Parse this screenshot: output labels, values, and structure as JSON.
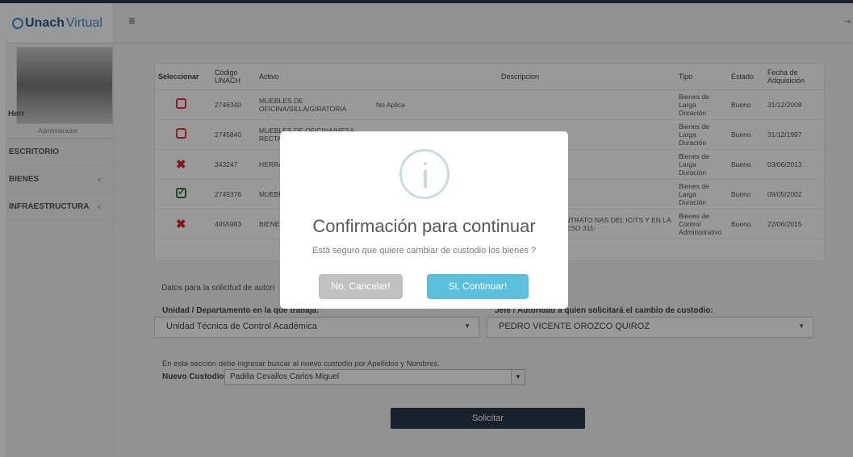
{
  "brand": {
    "bold": "Unach",
    "light": "Virtual"
  },
  "profile": {
    "name": "Herr",
    "role": "Administrador"
  },
  "nav": [
    {
      "label": "ESCRITORIO",
      "chevron": ""
    },
    {
      "label": "BIENES",
      "chevron": "<"
    },
    {
      "label": "INFRAESTRUCTURA",
      "chevron": "<"
    }
  ],
  "table": {
    "headers": [
      "Seleccionar",
      "Código UNACH",
      "Activo",
      "",
      "Descripcion",
      "Tipo",
      "Estado",
      "Fecha de Adquisición"
    ],
    "rows": [
      {
        "select": "unchecked",
        "codigo": "2746340",
        "activo": "MUEBLES DE OFICINA/SILLA/GIRATORIA",
        "extra": "No Aplica",
        "descripcion": "",
        "tipo": "Bienes de Larga Duración",
        "estado": "Bueno",
        "fecha": "31/12/2008"
      },
      {
        "select": "unchecked",
        "codigo": "2745840",
        "activo": "MUEBLES DE OFICINA/MESA RECTA",
        "extra": "",
        "descripcion": "",
        "tipo": "Bienes de Larga Duración",
        "estado": "Bueno",
        "fecha": "31/12/1997"
      },
      {
        "select": "x",
        "codigo": "343247",
        "activo": "HERRA ESPEC MANU",
        "extra": "",
        "descripcion": "",
        "tipo": "Bienes de Larga Duración",
        "estado": "Bueno",
        "fecha": "03/06/2013"
      },
      {
        "select": "checked",
        "codigo": "2749376",
        "activo": "MUEBI OFICIN",
        "extra": "",
        "descripcion": "",
        "tipo": "Bienes de Larga Duración",
        "estado": "Bueno",
        "fecha": "09/05/2002"
      },
      {
        "select": "x",
        "codigo": "4955983",
        "activo": "BIENES CONTI VOLTA",
        "extra": "",
        "descripcion": "RIOS EQUIPOS, CONTRATO NAS DEL ICITS Y EN LA VENDA ╞æO ,PROCESO 311-",
        "tipo": "Bienes de Control Administrativo",
        "estado": "Bueno",
        "fecha": "22/06/2015"
      }
    ]
  },
  "form": {
    "intro": "Datos para la solicitud de autori",
    "unidad_label": "Unidad / Departamento en la que trabaja:",
    "unidad_value": "Unidad Técnica de Control Académica",
    "jefe_label": "Jefe / Autoridad a quien solicitará el cambio de custodio:",
    "jefe_value": "PEDRO VICENTE OROZCO QUIROZ",
    "search_hint": "En esta sección debe ingresar buscar al nuevo custodio por Apellidos y Nombres.",
    "custodio_label": "Nuevo Custodio",
    "custodio_value": "Padilla Cevallos Carlos Miguel",
    "submit": "Solicitar"
  },
  "modal": {
    "title": "Confirmación para continuar",
    "text": "Está seguro que quiere cambiar de custodio los bienes ?",
    "cancel": "No, Cancelar!",
    "confirm": "Si, Continuar!"
  },
  "colors": {
    "primary": "#5bc0de",
    "dark": "#2b3a4a",
    "danger": "#e3262a",
    "success": "#2a7d32"
  }
}
